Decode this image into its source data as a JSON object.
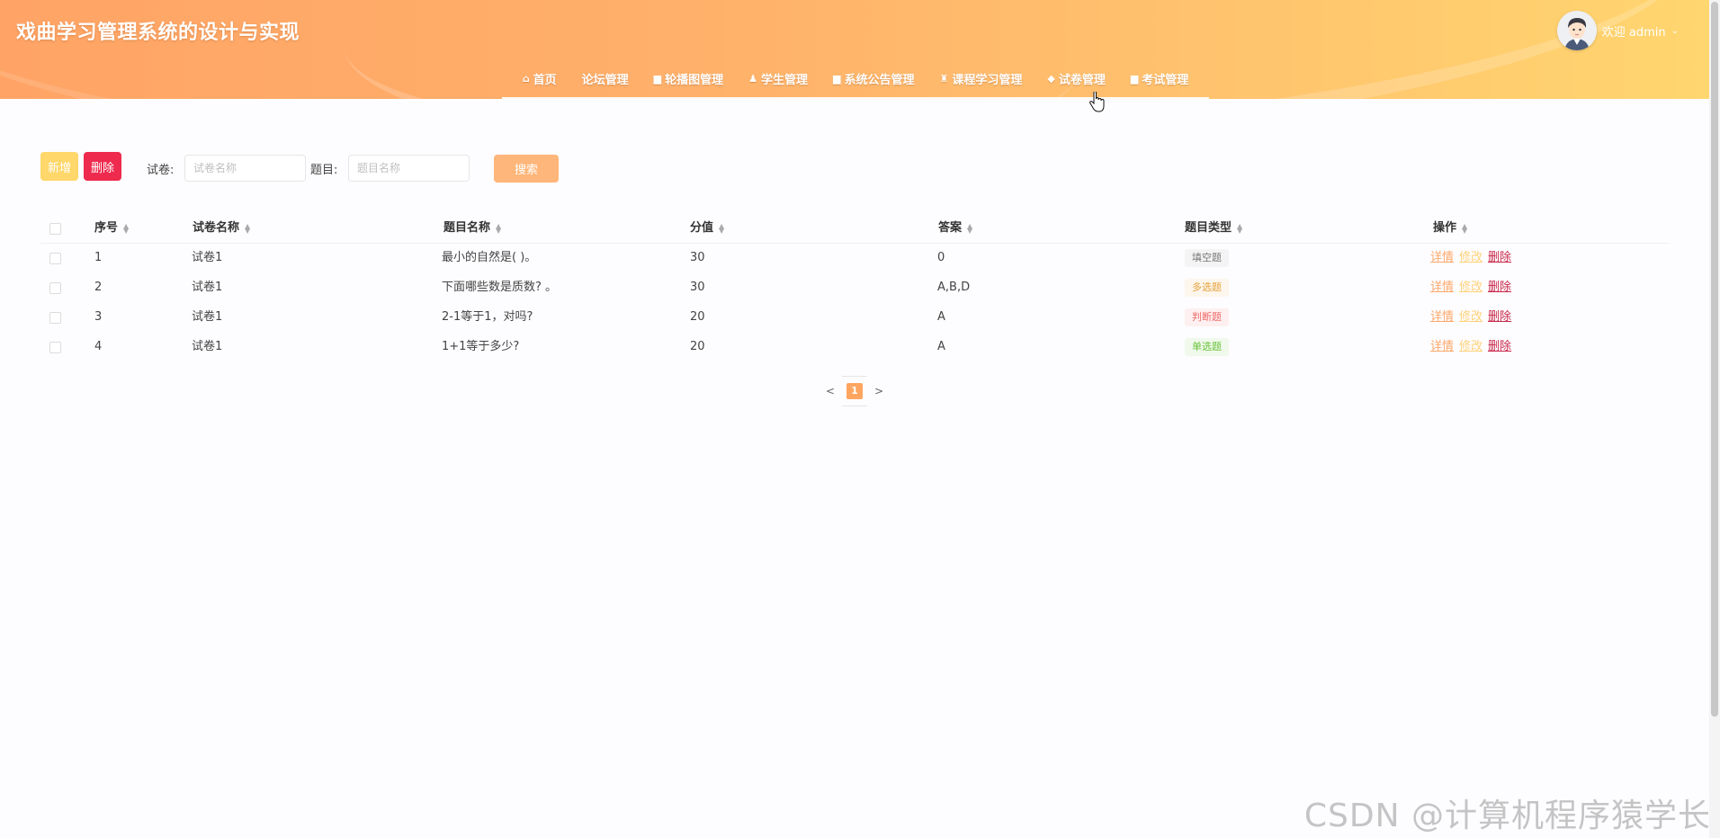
{
  "header": {
    "title": "戏曲学习管理系统的设计与实现",
    "welcome": "欢迎 admin",
    "nav": [
      {
        "label": "首页",
        "icon": "home-icon",
        "glyph": "⌂"
      },
      {
        "label": "论坛管理",
        "icon": "",
        "glyph": ""
      },
      {
        "label": "轮播图管理",
        "icon": "image-icon",
        "glyph": "▆"
      },
      {
        "label": "学生管理",
        "icon": "user-icon",
        "glyph": "♟"
      },
      {
        "label": "系统公告管理",
        "icon": "notice-icon",
        "glyph": "▆"
      },
      {
        "label": "课程学习管理",
        "icon": "course-icon",
        "glyph": "♜"
      },
      {
        "label": "试卷管理",
        "icon": "paper-icon",
        "glyph": "◆"
      },
      {
        "label": "考试管理",
        "icon": "exam-icon",
        "glyph": "▆"
      }
    ]
  },
  "toolbar": {
    "add_label": "新增",
    "delete_label": "删除",
    "paper_label": "试卷:",
    "paper_placeholder": "试卷名称",
    "question_label": "题目:",
    "question_placeholder": "题目名称",
    "search_label": "搜索"
  },
  "table": {
    "columns": [
      "序号",
      "试卷名称",
      "题目名称",
      "分值",
      "答案",
      "题目类型",
      "操作"
    ],
    "rows": [
      {
        "no": "1",
        "paper": "试卷1",
        "question": "最小的自然是( )。",
        "score": "30",
        "answer": "0",
        "type": "填空题"
      },
      {
        "no": "2",
        "paper": "试卷1",
        "question": "下面哪些数是质数? 。",
        "score": "30",
        "answer": "A,B,D",
        "type": "多选题"
      },
      {
        "no": "3",
        "paper": "试卷1",
        "question": "2-1等于1，对吗?",
        "score": "20",
        "answer": "A",
        "type": "判断题"
      },
      {
        "no": "4",
        "paper": "试卷1",
        "question": "1+1等于多少?",
        "score": "20",
        "answer": "A",
        "type": "单选题"
      }
    ],
    "ops": {
      "detail": "详情",
      "edit": "修改",
      "delete": "删除"
    }
  },
  "type_colors": {
    "填空题": {
      "fg": "#777777",
      "bg": "#f4f4f5"
    },
    "多选题": {
      "fg": "#e6a23c",
      "bg": "#fdf6ec"
    },
    "判断题": {
      "fg": "#f06a6a",
      "bg": "#fef0f0"
    },
    "单选题": {
      "fg": "#67c23a",
      "bg": "#f0f9eb"
    }
  },
  "op_colors": {
    "detail": "#ffa86a",
    "edit": "#ffd27a",
    "delete": "#c8284a"
  },
  "pagination": {
    "prev": "<",
    "current": "1",
    "next": ">"
  },
  "watermark": "CSDN @计算机程序猿学长"
}
